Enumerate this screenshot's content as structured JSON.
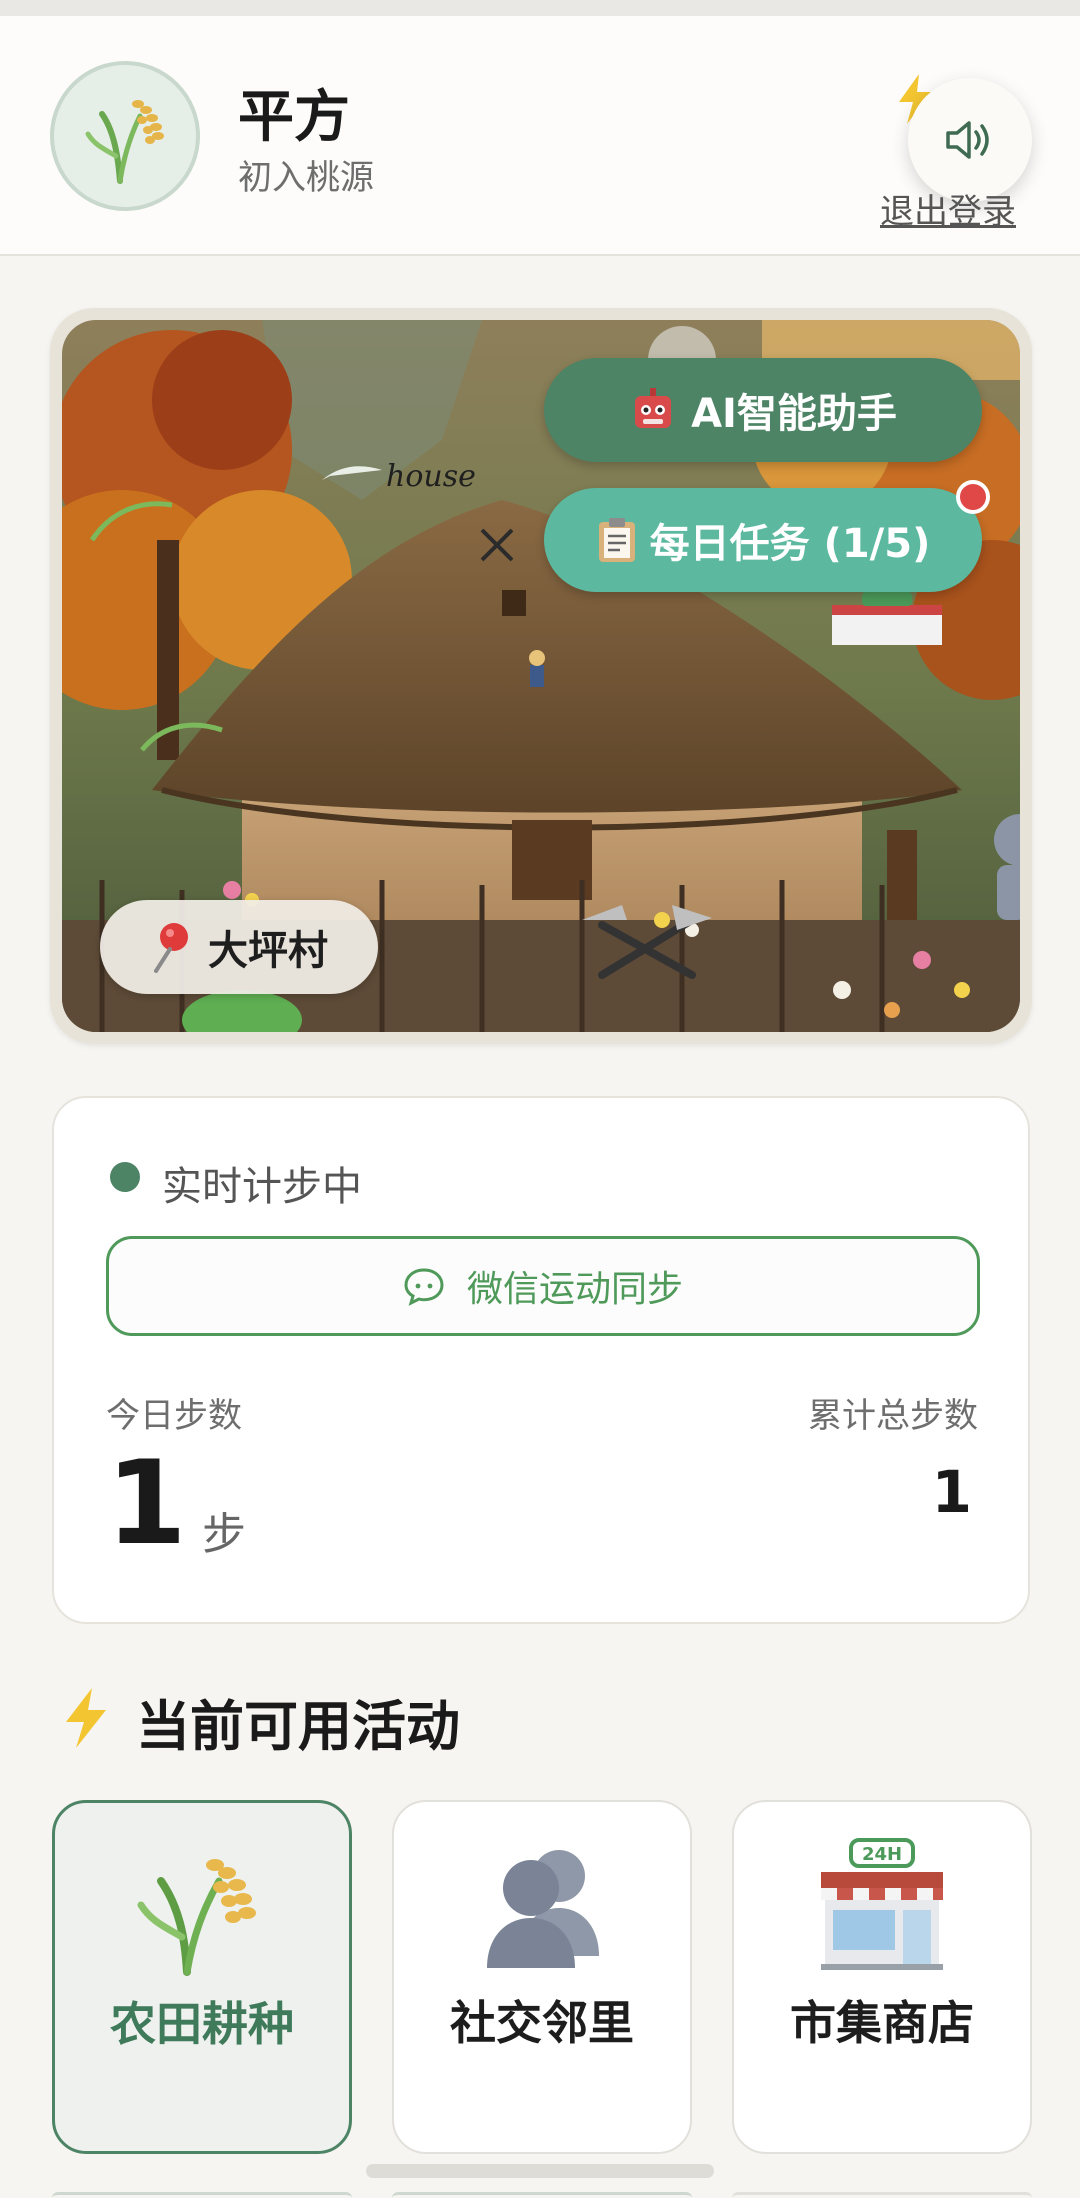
{
  "header": {
    "user_name": "平方",
    "user_level": "初入桃源",
    "logout_label": "退出登录",
    "avatar_icon": "rice-plant-icon",
    "sound_icon": "speaker-icon"
  },
  "hero": {
    "ai_assistant_label": "AI智能助手",
    "ai_icon": "robot-icon",
    "daily_task_label": "每日任务 (1/5)",
    "daily_task_icon": "clipboard-icon",
    "village_name": "大坪村",
    "village_icon": "pin-icon",
    "scene_sign_text": "house"
  },
  "steps": {
    "live_status": "实时计步中",
    "sync_button_label": "微信运动同步",
    "today_label": "今日步数",
    "today_value": "1",
    "today_unit": "步",
    "total_label": "累计总步数",
    "total_value": "1"
  },
  "activities": {
    "section_title": "当前可用活动",
    "items": [
      {
        "label": "农田耕种",
        "icon": "rice-plant-icon",
        "active": true
      },
      {
        "label": "社交邻里",
        "icon": "people-icon",
        "active": false
      },
      {
        "label": "市集商店",
        "icon": "store-24h-icon",
        "active": false
      }
    ]
  },
  "colors": {
    "primary_green": "#4d8466",
    "teal": "#5cb9a0",
    "wechat_green": "#4f9a5a",
    "badge_red": "#e04848",
    "background": "#f6f5f1"
  }
}
